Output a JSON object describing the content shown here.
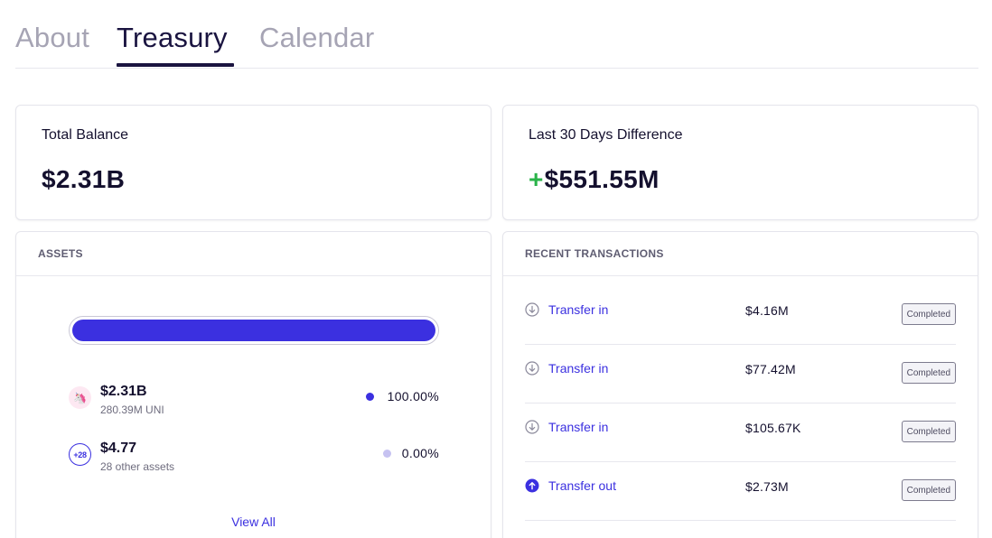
{
  "tabs": [
    {
      "label": "About"
    },
    {
      "label": "Treasury"
    },
    {
      "label": "Calendar"
    }
  ],
  "active_tab": "Treasury",
  "total_balance": {
    "label": "Total Balance",
    "value": "$2.31B"
  },
  "difference": {
    "label": "Last 30 Days Difference",
    "sign": "+",
    "value": "$551.55M"
  },
  "assets": {
    "title": "ASSETS",
    "bar_fill_fraction": 1.0,
    "items": [
      {
        "amount": "$2.31B",
        "sub": "280.39M UNI",
        "percent": "100.00%",
        "icon": "uniswap-icon",
        "icon_text": "🦄",
        "dot_color": "#3b30e0"
      },
      {
        "amount": "$4.77",
        "sub": "28 other assets",
        "percent": "0.00%",
        "icon": "more-assets-icon",
        "icon_text": "+28",
        "dot_color": "#c6c2f1"
      }
    ],
    "view_all": "View All"
  },
  "transactions": {
    "title": "RECENT TRANSACTIONS",
    "items": [
      {
        "type": "Transfer in",
        "amount": "$4.16M",
        "status": "Completed",
        "icon": "arrow-down-circle-icon"
      },
      {
        "type": "Transfer in",
        "amount": "$77.42M",
        "status": "Completed",
        "icon": "arrow-down-circle-icon"
      },
      {
        "type": "Transfer in",
        "amount": "$105.67K",
        "status": "Completed",
        "icon": "arrow-down-circle-icon"
      },
      {
        "type": "Transfer out",
        "amount": "$2.73M",
        "status": "Completed",
        "icon": "arrow-up-circle-icon"
      }
    ]
  },
  "colors": {
    "accent": "#3b30e0",
    "positive": "#2ab34a",
    "text": "#14102e",
    "muted_tab": "#a6a4b4"
  }
}
